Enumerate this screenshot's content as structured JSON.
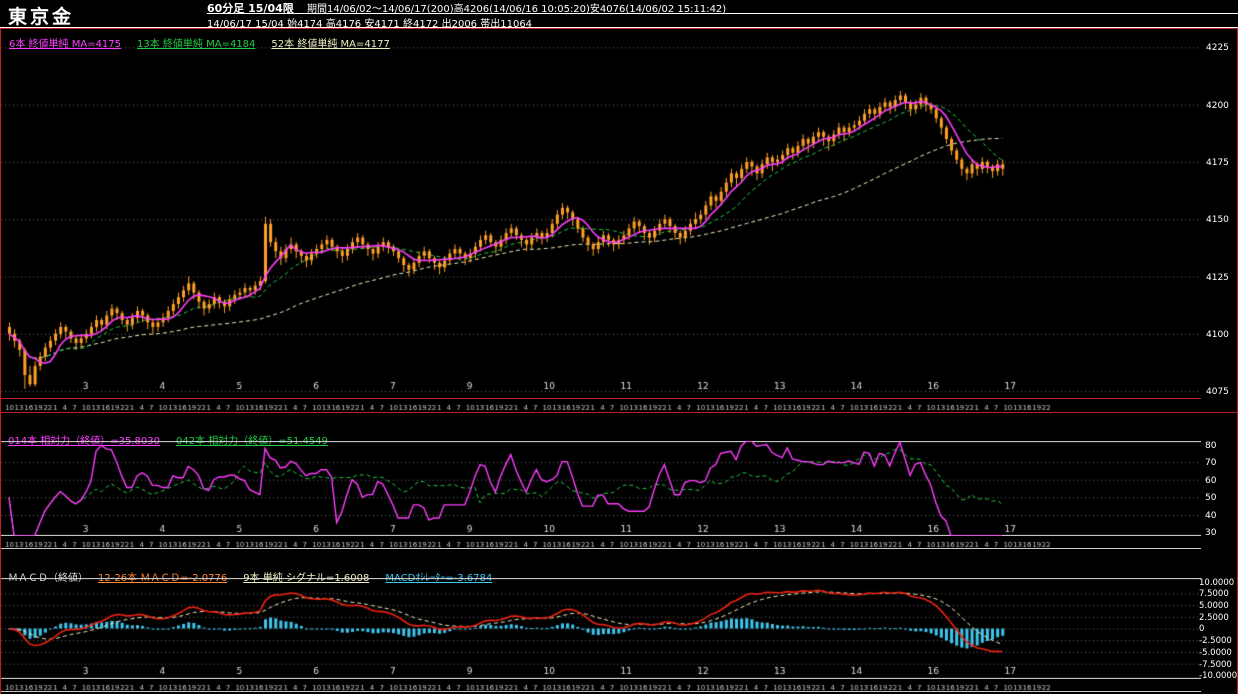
{
  "header": {
    "title": "東京金",
    "timeframe": "60分足 15/04限",
    "period": "期間14/06/02～14/06/17(200)高4206(14/06/16 10:05:20)安4076(14/06/02 15:11:42)",
    "quote": "14/06/17 15/04 始4174 高4176 安4171 終4172 出2006 帯出11064"
  },
  "main_chart": {
    "legend": [
      {
        "label": "6本 終値単純 MA=4175",
        "color": "#ff3dff"
      },
      {
        "label": "13本 終値単純 MA=4184",
        "color": "#22cc44"
      },
      {
        "label": "52本 終値単純 MA=4177",
        "color": "#eeeec0"
      }
    ],
    "y_ticks": [
      "4225",
      "4200",
      "4175",
      "4150",
      "4125",
      "4100",
      "4075"
    ]
  },
  "rsi_panel": {
    "legend": [
      {
        "label": "014本 相対力（終値）=35.8030",
        "color": "#ff3dff"
      },
      {
        "label": "042本 相対力（終値）=51.4549",
        "color": "#22cc44"
      }
    ],
    "y_ticks": [
      "80",
      "70",
      "60",
      "50",
      "40",
      "30"
    ]
  },
  "macd_panel": {
    "title": "ＭＡＣＤ（終値）",
    "legend": [
      {
        "label": "12-26本 ＭＡＣＤ=-2.0776",
        "color": "#ff8833"
      },
      {
        "label": "9本 単純 シグナル=1.6008",
        "color": "#eeeec0"
      },
      {
        "label": "MACDｵｼﾚｰﾀｰ=-3.6784",
        "color": "#3ec6ee"
      }
    ],
    "y_ticks": [
      "10.0000",
      "7.5000",
      "5.0000",
      "2.5000",
      "0",
      "-2.5000",
      "-5.0000",
      "-7.5000",
      "-10.0000"
    ]
  },
  "x_axis": {
    "days": [
      "3",
      "4",
      "5",
      "6",
      "7",
      "9",
      "10",
      "11",
      "12",
      "13",
      "14",
      "16",
      "17"
    ],
    "times": [
      "10",
      "13",
      "16",
      "19",
      "22",
      "1",
      "4",
      "7"
    ]
  },
  "chart_data": {
    "type": "candlestick",
    "title": "東京金 60分足 15/04限",
    "period_label": "14/06/02～14/06/17 (200本)",
    "high_label": "高4206 (14/06/16 10:05:20)",
    "low_label": "安4076 (14/06/02 15:11:42)",
    "last_bar": {
      "open": 4174,
      "high": 4176,
      "low": 4171,
      "close": 4172,
      "volume": 2006,
      "open_interest": 11064
    },
    "y_axis_main": {
      "min": 4075,
      "max": 4225,
      "ticks": [
        4225,
        4200,
        4175,
        4150,
        4125,
        4100,
        4075
      ],
      "grid": "dashed"
    },
    "indicators": {
      "moving_averages": [
        {
          "period": 6,
          "type": "終値単純",
          "last": 4175
        },
        {
          "period": 13,
          "type": "終値単純",
          "last": 4184
        },
        {
          "period": 52,
          "type": "終値単純",
          "last": 4177
        }
      ],
      "rsi": [
        {
          "period": 14,
          "last": 35.803
        },
        {
          "period": 42,
          "last": 51.4549
        }
      ],
      "rsi_axis": {
        "min": 30,
        "max": 80,
        "ticks": [
          80,
          70,
          60,
          50,
          40,
          30
        ]
      },
      "macd": {
        "fast": 12,
        "slow": 26,
        "signal_period": 9,
        "macd_last": -2.0776,
        "signal_last": 1.6008,
        "oscillator_last": -3.6784
      },
      "macd_axis": {
        "min": -10,
        "max": 10,
        "ticks": [
          10,
          7.5,
          5,
          2.5,
          0,
          -2.5,
          -5,
          -7.5,
          -10
        ]
      }
    },
    "ohlc_units": "[open,high,low,close] per 60-min bar, values estimated from chart pixels",
    "candles": [
      [
        4103,
        4105,
        4097,
        4100
      ],
      [
        4100,
        4102,
        4094,
        4097
      ],
      [
        4097,
        4098,
        4090,
        4093
      ],
      [
        4093,
        4094,
        4076,
        4082
      ],
      [
        4082,
        4086,
        4077,
        4078
      ],
      [
        4078,
        4088,
        4077,
        4086
      ],
      [
        4086,
        4092,
        4084,
        4090
      ],
      [
        4090,
        4096,
        4088,
        4094
      ],
      [
        4094,
        4099,
        4092,
        4097
      ],
      [
        4097,
        4102,
        4095,
        4100
      ],
      [
        4100,
        4105,
        4098,
        4103
      ],
      [
        4103,
        4104,
        4098,
        4101
      ],
      [
        4101,
        4102,
        4096,
        4098
      ],
      [
        4098,
        4099,
        4093,
        4096
      ],
      [
        4096,
        4100,
        4094,
        4098
      ],
      [
        4098,
        4102,
        4096,
        4100
      ],
      [
        4100,
        4105,
        4098,
        4103
      ],
      [
        4103,
        4108,
        4101,
        4106
      ],
      [
        4106,
        4107,
        4101,
        4104
      ],
      [
        4104,
        4110,
        4102,
        4108
      ],
      [
        4108,
        4113,
        4106,
        4111
      ],
      [
        4111,
        4112,
        4106,
        4109
      ],
      [
        4109,
        4110,
        4104,
        4106
      ],
      [
        4106,
        4107,
        4101,
        4104
      ],
      [
        4104,
        4109,
        4102,
        4107
      ],
      [
        4107,
        4112,
        4105,
        4110
      ],
      [
        4110,
        4111,
        4105,
        4108
      ],
      [
        4108,
        4109,
        4102,
        4105
      ],
      [
        4105,
        4106,
        4100,
        4103
      ],
      [
        4103,
        4107,
        4101,
        4105
      ],
      [
        4105,
        4109,
        4103,
        4107
      ],
      [
        4107,
        4112,
        4105,
        4110
      ],
      [
        4110,
        4115,
        4108,
        4113
      ],
      [
        4113,
        4118,
        4111,
        4116
      ],
      [
        4116,
        4121,
        4114,
        4119
      ],
      [
        4119,
        4125,
        4117,
        4122
      ],
      [
        4122,
        4123,
        4115,
        4118
      ],
      [
        4118,
        4119,
        4111,
        4114
      ],
      [
        4114,
        4115,
        4108,
        4111
      ],
      [
        4111,
        4115,
        4109,
        4113
      ],
      [
        4113,
        4118,
        4111,
        4116
      ],
      [
        4116,
        4117,
        4111,
        4114
      ],
      [
        4114,
        4115,
        4109,
        4112
      ],
      [
        4112,
        4117,
        4110,
        4115
      ],
      [
        4115,
        4119,
        4113,
        4117
      ],
      [
        4117,
        4120,
        4115,
        4118
      ],
      [
        4118,
        4122,
        4116,
        4120
      ],
      [
        4120,
        4121,
        4116,
        4119
      ],
      [
        4119,
        4123,
        4117,
        4121
      ],
      [
        4121,
        4125,
        4119,
        4123
      ],
      [
        4123,
        4151,
        4122,
        4148
      ],
      [
        4148,
        4150,
        4138,
        4140
      ],
      [
        4140,
        4142,
        4133,
        4136
      ],
      [
        4136,
        4138,
        4130,
        4133
      ],
      [
        4133,
        4139,
        4131,
        4137
      ],
      [
        4137,
        4142,
        4135,
        4139
      ],
      [
        4139,
        4140,
        4133,
        4136
      ],
      [
        4136,
        4137,
        4131,
        4134
      ],
      [
        4134,
        4135,
        4129,
        4132
      ],
      [
        4132,
        4137,
        4130,
        4135
      ],
      [
        4135,
        4139,
        4133,
        4137
      ],
      [
        4137,
        4141,
        4135,
        4139
      ],
      [
        4139,
        4143,
        4137,
        4141
      ],
      [
        4141,
        4142,
        4136,
        4138
      ],
      [
        4138,
        4139,
        4133,
        4136
      ],
      [
        4136,
        4137,
        4131,
        4134
      ],
      [
        4134,
        4139,
        4132,
        4137
      ],
      [
        4137,
        4142,
        4135,
        4140
      ],
      [
        4140,
        4144,
        4138,
        4142
      ],
      [
        4142,
        4143,
        4137,
        4139
      ],
      [
        4139,
        4140,
        4134,
        4137
      ],
      [
        4137,
        4138,
        4132,
        4135
      ],
      [
        4135,
        4140,
        4133,
        4138
      ],
      [
        4138,
        4142,
        4136,
        4140
      ],
      [
        4140,
        4141,
        4135,
        4138
      ],
      [
        4138,
        4139,
        4134,
        4136
      ],
      [
        4136,
        4137,
        4131,
        4133
      ],
      [
        4133,
        4134,
        4127,
        4130
      ],
      [
        4130,
        4131,
        4125,
        4128
      ],
      [
        4128,
        4133,
        4126,
        4131
      ],
      [
        4131,
        4136,
        4129,
        4134
      ],
      [
        4134,
        4138,
        4132,
        4136
      ],
      [
        4136,
        4137,
        4131,
        4133
      ],
      [
        4133,
        4134,
        4128,
        4131
      ],
      [
        4131,
        4132,
        4126,
        4129
      ],
      [
        4129,
        4134,
        4127,
        4132
      ],
      [
        4132,
        4137,
        4130,
        4135
      ],
      [
        4135,
        4139,
        4133,
        4137
      ],
      [
        4137,
        4138,
        4132,
        4135
      ],
      [
        4135,
        4136,
        4130,
        4133
      ],
      [
        4133,
        4137,
        4131,
        4135
      ],
      [
        4135,
        4140,
        4133,
        4138
      ],
      [
        4138,
        4143,
        4136,
        4141
      ],
      [
        4141,
        4145,
        4139,
        4143
      ],
      [
        4143,
        4144,
        4138,
        4140
      ],
      [
        4140,
        4141,
        4135,
        4138
      ],
      [
        4138,
        4143,
        4136,
        4141
      ],
      [
        4141,
        4146,
        4139,
        4144
      ],
      [
        4144,
        4148,
        4142,
        4146
      ],
      [
        4146,
        4147,
        4141,
        4143
      ],
      [
        4143,
        4144,
        4138,
        4141
      ],
      [
        4141,
        4142,
        4136,
        4139
      ],
      [
        4139,
        4144,
        4137,
        4142
      ],
      [
        4142,
        4146,
        4140,
        4144
      ],
      [
        4144,
        4145,
        4139,
        4142
      ],
      [
        4142,
        4146,
        4140,
        4144
      ],
      [
        4144,
        4150,
        4142,
        4148
      ],
      [
        4148,
        4154,
        4146,
        4152
      ],
      [
        4152,
        4157,
        4150,
        4155
      ],
      [
        4155,
        4156,
        4150,
        4153
      ],
      [
        4153,
        4154,
        4147,
        4150
      ],
      [
        4150,
        4151,
        4144,
        4146
      ],
      [
        4146,
        4147,
        4140,
        4142
      ],
      [
        4142,
        4143,
        4136,
        4139
      ],
      [
        4139,
        4140,
        4134,
        4137
      ],
      [
        4137,
        4142,
        4135,
        4140
      ],
      [
        4140,
        4145,
        4138,
        4143
      ],
      [
        4143,
        4144,
        4138,
        4141
      ],
      [
        4141,
        4142,
        4136,
        4139
      ],
      [
        4139,
        4143,
        4137,
        4141
      ],
      [
        4141,
        4145,
        4139,
        4143
      ],
      [
        4143,
        4148,
        4141,
        4146
      ],
      [
        4146,
        4151,
        4144,
        4149
      ],
      [
        4149,
        4150,
        4144,
        4147
      ],
      [
        4147,
        4148,
        4141,
        4144
      ],
      [
        4144,
        4145,
        4139,
        4142
      ],
      [
        4142,
        4147,
        4140,
        4145
      ],
      [
        4145,
        4150,
        4143,
        4148
      ],
      [
        4148,
        4152,
        4146,
        4150
      ],
      [
        4150,
        4151,
        4144,
        4147
      ],
      [
        4147,
        4148,
        4141,
        4144
      ],
      [
        4144,
        4145,
        4139,
        4142
      ],
      [
        4142,
        4147,
        4140,
        4145
      ],
      [
        4145,
        4150,
        4143,
        4148
      ],
      [
        4148,
        4153,
        4146,
        4150
      ],
      [
        4150,
        4154,
        4148,
        4152
      ],
      [
        4152,
        4158,
        4150,
        4156
      ],
      [
        4156,
        4162,
        4154,
        4160
      ],
      [
        4160,
        4161,
        4155,
        4158
      ],
      [
        4158,
        4164,
        4156,
        4162
      ],
      [
        4162,
        4168,
        4160,
        4166
      ],
      [
        4166,
        4172,
        4164,
        4170
      ],
      [
        4170,
        4171,
        4164,
        4168
      ],
      [
        4168,
        4174,
        4166,
        4172
      ],
      [
        4172,
        4177,
        4170,
        4175
      ],
      [
        4175,
        4176,
        4169,
        4173
      ],
      [
        4173,
        4174,
        4167,
        4170
      ],
      [
        4170,
        4176,
        4168,
        4174
      ],
      [
        4174,
        4179,
        4172,
        4177
      ],
      [
        4177,
        4178,
        4171,
        4175
      ],
      [
        4175,
        4178,
        4173,
        4176
      ],
      [
        4176,
        4180,
        4174,
        4178
      ],
      [
        4178,
        4183,
        4176,
        4181
      ],
      [
        4181,
        4182,
        4176,
        4179
      ],
      [
        4179,
        4184,
        4177,
        4182
      ],
      [
        4182,
        4187,
        4180,
        4185
      ],
      [
        4185,
        4186,
        4179,
        4183
      ],
      [
        4183,
        4188,
        4181,
        4186
      ],
      [
        4186,
        4190,
        4184,
        4188
      ],
      [
        4188,
        4189,
        4182,
        4186
      ],
      [
        4186,
        4187,
        4180,
        4184
      ],
      [
        4184,
        4189,
        4182,
        4187
      ],
      [
        4187,
        4192,
        4185,
        4190
      ],
      [
        4190,
        4191,
        4184,
        4188
      ],
      [
        4188,
        4192,
        4186,
        4190
      ],
      [
        4190,
        4193,
        4188,
        4191
      ],
      [
        4191,
        4195,
        4189,
        4193
      ],
      [
        4193,
        4198,
        4191,
        4196
      ],
      [
        4196,
        4200,
        4194,
        4198
      ],
      [
        4198,
        4199,
        4193,
        4196
      ],
      [
        4196,
        4201,
        4194,
        4199
      ],
      [
        4199,
        4203,
        4197,
        4201
      ],
      [
        4201,
        4202,
        4196,
        4199
      ],
      [
        4199,
        4204,
        4197,
        4202
      ],
      [
        4202,
        4206,
        4200,
        4204
      ],
      [
        4204,
        4205,
        4198,
        4201
      ],
      [
        4201,
        4202,
        4195,
        4198
      ],
      [
        4198,
        4202,
        4196,
        4200
      ],
      [
        4200,
        4205,
        4198,
        4203
      ],
      [
        4203,
        4204,
        4197,
        4200
      ],
      [
        4200,
        4201,
        4196,
        4198
      ],
      [
        4198,
        4199,
        4192,
        4194
      ],
      [
        4194,
        4195,
        4187,
        4190
      ],
      [
        4190,
        4191,
        4183,
        4185
      ],
      [
        4185,
        4186,
        4178,
        4180
      ],
      [
        4180,
        4181,
        4174,
        4176
      ],
      [
        4176,
        4177,
        4169,
        4172
      ],
      [
        4172,
        4173,
        4167,
        4170
      ],
      [
        4170,
        4176,
        4168,
        4174
      ],
      [
        4174,
        4175,
        4169,
        4172
      ],
      [
        4172,
        4177,
        4170,
        4175
      ],
      [
        4175,
        4176,
        4170,
        4173
      ],
      [
        4173,
        4174,
        4168,
        4171
      ],
      [
        4171,
        4176,
        4169,
        4174
      ],
      [
        4174,
        4176,
        4169,
        4172
      ]
    ],
    "colors": {
      "background": "#000000",
      "candle": "#ffa028",
      "ma6": "#ff3dff",
      "ma13": "#22cc44",
      "ma52": "#eeeec0",
      "rsi14": "#ff3dff",
      "rsi42": "#22cc44",
      "macd": "#ee2211",
      "signal": "#eeeec0",
      "histogram": "#3ec6ee",
      "grid": "#9a9a9a",
      "frame_red": "#c22020",
      "frame_white": "#dddddd"
    }
  }
}
